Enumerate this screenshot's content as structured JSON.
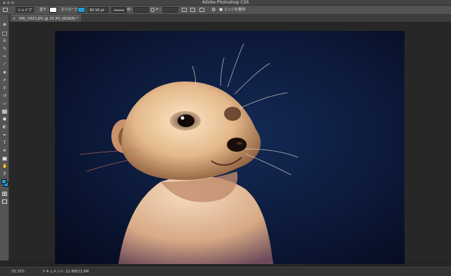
{
  "window": {
    "title": "Adobe Photoshop CS6"
  },
  "options_bar": {
    "shape_mode": "シェイプ",
    "fill_label": "塗り :",
    "stroke_label": "ストローク :",
    "stroke_width": "90.56 pt",
    "width_label": "W :",
    "height_label": "H :",
    "align_edges_label": "エッジを整列",
    "fill_color": "#ffffff",
    "stroke_color": "#1e9fdc"
  },
  "document_tab": {
    "close_glyph": "×",
    "title": "IMG_0923.JPG @ 33.3% (RGB/8) *"
  },
  "toolbar": {
    "tools": [
      "move-tool-icon",
      "marquee-tool-icon",
      "lasso-tool-icon",
      "quick-select-tool-icon",
      "crop-tool-icon",
      "eyedropper-tool-icon",
      "healing-brush-tool-icon",
      "brush-tool-icon",
      "clone-stamp-tool-icon",
      "history-brush-tool-icon",
      "eraser-tool-icon",
      "gradient-tool-icon",
      "blur-tool-icon",
      "dodge-tool-icon",
      "pen-tool-icon",
      "type-tool-icon",
      "path-select-tool-icon",
      "shape-tool-icon",
      "hand-tool-icon",
      "zoom-tool-icon"
    ],
    "foreground_color": "#1e9fdc",
    "background_color": "#1e9fdc"
  },
  "status_bar": {
    "zoom": "33.33%",
    "info": "ドキュメント: 22.8M/22.8M"
  }
}
